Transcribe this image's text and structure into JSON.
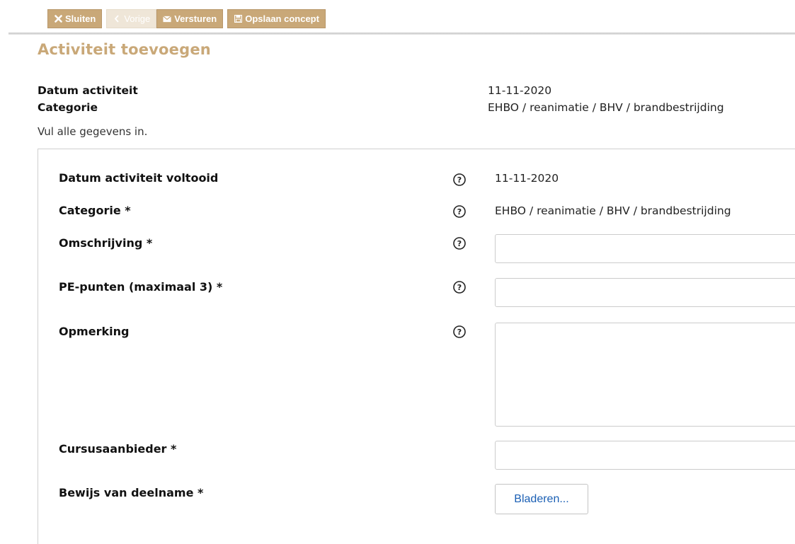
{
  "toolbar": {
    "close_label": "Sluiten",
    "close_icon": "close-icon",
    "prev_label": "Vorige",
    "prev_icon": "chevron-left-icon",
    "prev_disabled": true,
    "send_label": "Versturen",
    "send_icon": "envelope-icon",
    "save_label": "Opslaan concept",
    "save_icon": "save-icon"
  },
  "page": {
    "title": "Activiteit toevoegen"
  },
  "summary": {
    "date_label": "Datum activiteit",
    "date_value": "11-11-2020",
    "category_label": "Categorie",
    "category_value": "EHBO / reanimatie / BHV / brandbestrijding"
  },
  "hint": "Vul alle gegevens in.",
  "form": {
    "date_completed": {
      "label": "Datum activiteit voltooid",
      "value": "11-11-2020"
    },
    "category": {
      "label": "Categorie *",
      "value": "EHBO / reanimatie / BHV / brandbestrijding"
    },
    "description": {
      "label": "Omschrijving *",
      "value": ""
    },
    "pe_points": {
      "label": "PE-punten (maximaal 3) *",
      "value": ""
    },
    "remark": {
      "label": "Opmerking",
      "value": ""
    },
    "course_provider": {
      "label": "Cursusaanbieder *",
      "value": ""
    },
    "proof": {
      "label": "Bewijs van deelname *",
      "button_label": "Bladeren..."
    }
  },
  "colors": {
    "accent": "#c9a878",
    "accent_disabled": "#efe6d8",
    "link_blue": "#1a5fb4"
  }
}
